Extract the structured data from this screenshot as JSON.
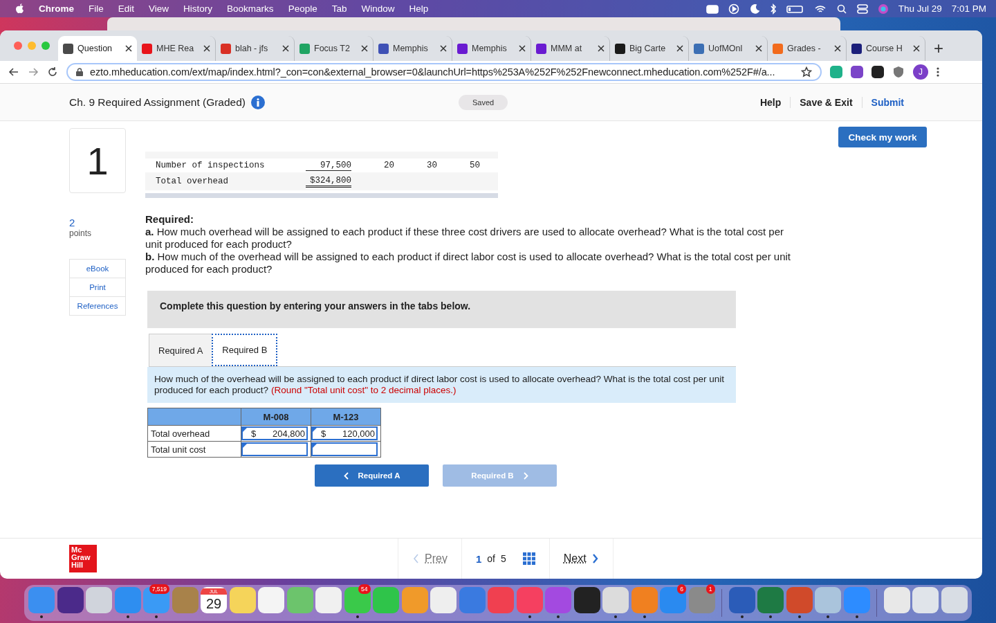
{
  "menubar": {
    "items": [
      "Chrome",
      "File",
      "Edit",
      "View",
      "History",
      "Bookmarks",
      "People",
      "Tab",
      "Window",
      "Help"
    ],
    "date": "Thu Jul 29",
    "time": "7:01 PM"
  },
  "browser": {
    "tabs": [
      {
        "title": "Question",
        "color": "#4a4a4a",
        "selected": true
      },
      {
        "title": "MHE Rea",
        "color": "#e8141b",
        "selected": false
      },
      {
        "title": "blah - jfs",
        "color": "#d93025",
        "selected": false
      },
      {
        "title": "Focus T2",
        "color": "#1fa463",
        "selected": false
      },
      {
        "title": "Memphis",
        "color": "#3f51b5",
        "selected": false
      },
      {
        "title": "Memphis",
        "color": "#6a1bd1",
        "selected": false
      },
      {
        "title": "MMM at",
        "color": "#6a1bd1",
        "selected": false
      },
      {
        "title": "Big Carte",
        "color": "#1a1a1a",
        "selected": false
      },
      {
        "title": "UofMOnl",
        "color": "#3c6fb4",
        "selected": false
      },
      {
        "title": "Grades -",
        "color": "#f26b1d",
        "selected": false
      },
      {
        "title": "Course H",
        "color": "#1b1f7a",
        "selected": false
      }
    ],
    "new_tab": "+",
    "url": "ezto.mheducation.com/ext/map/index.html?_con=con&external_browser=0&launchUrl=https%253A%252F%252Fnewconnect.mheducation.com%252F#/a...",
    "profile": "J"
  },
  "header": {
    "title": "Ch. 9 Required Assignment (Graded)",
    "status": "Saved",
    "links": [
      "Help",
      "Save & Exit",
      "Submit"
    ]
  },
  "check_button": "Check my work",
  "question": {
    "number": "1",
    "points_value": "2",
    "points_label": "points",
    "resources": [
      "eBook",
      "Print",
      "References"
    ]
  },
  "data_table": {
    "rows": [
      {
        "label": "Number of inspections",
        "values": [
          "97,500",
          "20",
          "30",
          "50"
        ],
        "kind": "plain"
      },
      {
        "label": "Total overhead",
        "values": [
          "$324,800"
        ],
        "kind": "total"
      }
    ]
  },
  "required": {
    "heading": "Required:",
    "items": [
      "**a.** How much overhead will be assigned to each product if these three cost drivers are used to allocate overhead? What is the total cost per unit produced for each product?",
      "**b.** How much of the overhead will be assigned to each product if direct labor cost is used to allocate overhead? What is the total cost per unit produced for each product?"
    ]
  },
  "instruction": "Complete this question by entering your answers in the tabs below.",
  "answer_tabs": [
    {
      "label": "Required A",
      "selected": false
    },
    {
      "label": "Required B",
      "selected": true
    }
  ],
  "prompt": {
    "text": "How much of the overhead will be assigned to each product if direct labor cost is used to allocate overhead? What is the total cost per unit produced for each product?",
    "note": "(Round \"Total unit cost\" to 2 decimal places.)"
  },
  "answer_table": {
    "columns": [
      "M-008",
      "M-123"
    ],
    "rows": [
      {
        "label": "Total overhead",
        "cells": [
          {
            "kind": "amount",
            "prefix": "$",
            "value": "204,800"
          },
          {
            "kind": "amount",
            "prefix": "$",
            "value": "120,000"
          }
        ]
      },
      {
        "label": "Total unit cost",
        "cells": [
          {
            "kind": "empty"
          },
          {
            "kind": "empty"
          }
        ]
      }
    ]
  },
  "nav_buttons": [
    {
      "label": "Required A",
      "kind": "prev",
      "disabled": false
    },
    {
      "label": "Required B",
      "kind": "next",
      "disabled": true
    }
  ],
  "footer": {
    "logo": [
      "Mc",
      "Graw",
      "Hill"
    ],
    "prev": "Prev",
    "current": "1",
    "of": "of",
    "total": "5",
    "next": "Next"
  },
  "dock": [
    {
      "kind": "app",
      "color": "#3b8ff0",
      "running": true
    },
    {
      "kind": "app",
      "color": "#4b2a8a",
      "running": false
    },
    {
      "kind": "app",
      "color": "#d0d4dc",
      "running": false
    },
    {
      "kind": "app",
      "color": "#2e8ef0",
      "running": true
    },
    {
      "kind": "app",
      "color": "#3a9af5",
      "running": true,
      "badge": "7,519"
    },
    {
      "kind": "app",
      "color": "#a8824a",
      "running": false
    },
    {
      "kind": "calendar",
      "color": "#ffffff",
      "running": false,
      "month": "JUL",
      "day": "29"
    },
    {
      "kind": "app",
      "color": "#f5d45a",
      "running": false
    },
    {
      "kind": "app",
      "color": "#f4f4f4",
      "running": false
    },
    {
      "kind": "app",
      "color": "#6cc46c",
      "running": false
    },
    {
      "kind": "app",
      "color": "#f0f0f0",
      "running": false
    },
    {
      "kind": "app",
      "color": "#3ac94a",
      "running": true,
      "badge": "54"
    },
    {
      "kind": "app",
      "color": "#2fc44a",
      "running": false
    },
    {
      "kind": "app",
      "color": "#f09a2a",
      "running": false
    },
    {
      "kind": "app",
      "color": "#eeeeee",
      "running": false
    },
    {
      "kind": "app",
      "color": "#3a7ae0",
      "running": false
    },
    {
      "kind": "app",
      "color": "#f04050",
      "running": false
    },
    {
      "kind": "app",
      "color": "#f54060",
      "running": true
    },
    {
      "kind": "app",
      "color": "#a34ae0",
      "running": true
    },
    {
      "kind": "app",
      "color": "#222222",
      "running": false
    },
    {
      "kind": "app",
      "color": "#dcdcdc",
      "running": true
    },
    {
      "kind": "app",
      "color": "#f08020",
      "running": true
    },
    {
      "kind": "app",
      "color": "#2a8af0",
      "running": false,
      "badge": "6"
    },
    {
      "kind": "app",
      "color": "#8a8a8a",
      "running": false,
      "badge": "1"
    },
    {
      "kind": "separator"
    },
    {
      "kind": "app",
      "color": "#2b5cb8",
      "running": true
    },
    {
      "kind": "app",
      "color": "#1e7a44",
      "running": true
    },
    {
      "kind": "app",
      "color": "#d04a2a",
      "running": true
    },
    {
      "kind": "app",
      "color": "#aac4dc",
      "running": true
    },
    {
      "kind": "app",
      "color": "#2d8cff",
      "running": true
    },
    {
      "kind": "separator"
    },
    {
      "kind": "app",
      "color": "#e8e8e8",
      "running": false
    },
    {
      "kind": "app",
      "color": "#e0e4ea",
      "running": false
    },
    {
      "kind": "app",
      "color": "#d8dde4",
      "running": false
    }
  ]
}
